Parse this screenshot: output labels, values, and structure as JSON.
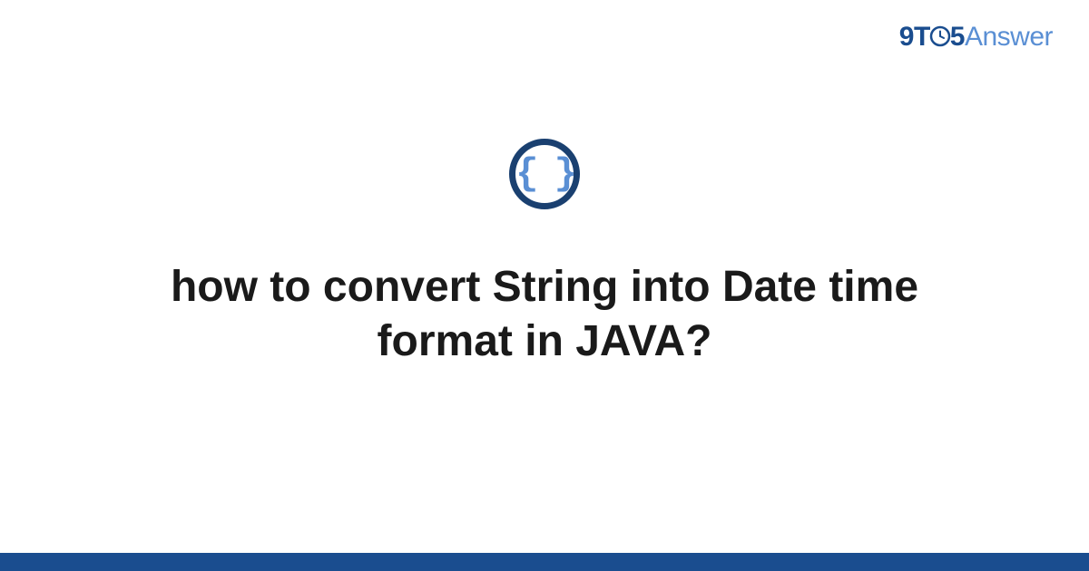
{
  "logo": {
    "part1": "9",
    "part2": "T",
    "part3": "5",
    "part4": "Answer"
  },
  "icon": {
    "name": "code-braces-icon",
    "glyph": "{ }"
  },
  "title": "how to convert String into Date time format in JAVA?",
  "colors": {
    "primary": "#1a4d8f",
    "accent": "#5a8fd4",
    "iconRing": "#1a4070"
  }
}
